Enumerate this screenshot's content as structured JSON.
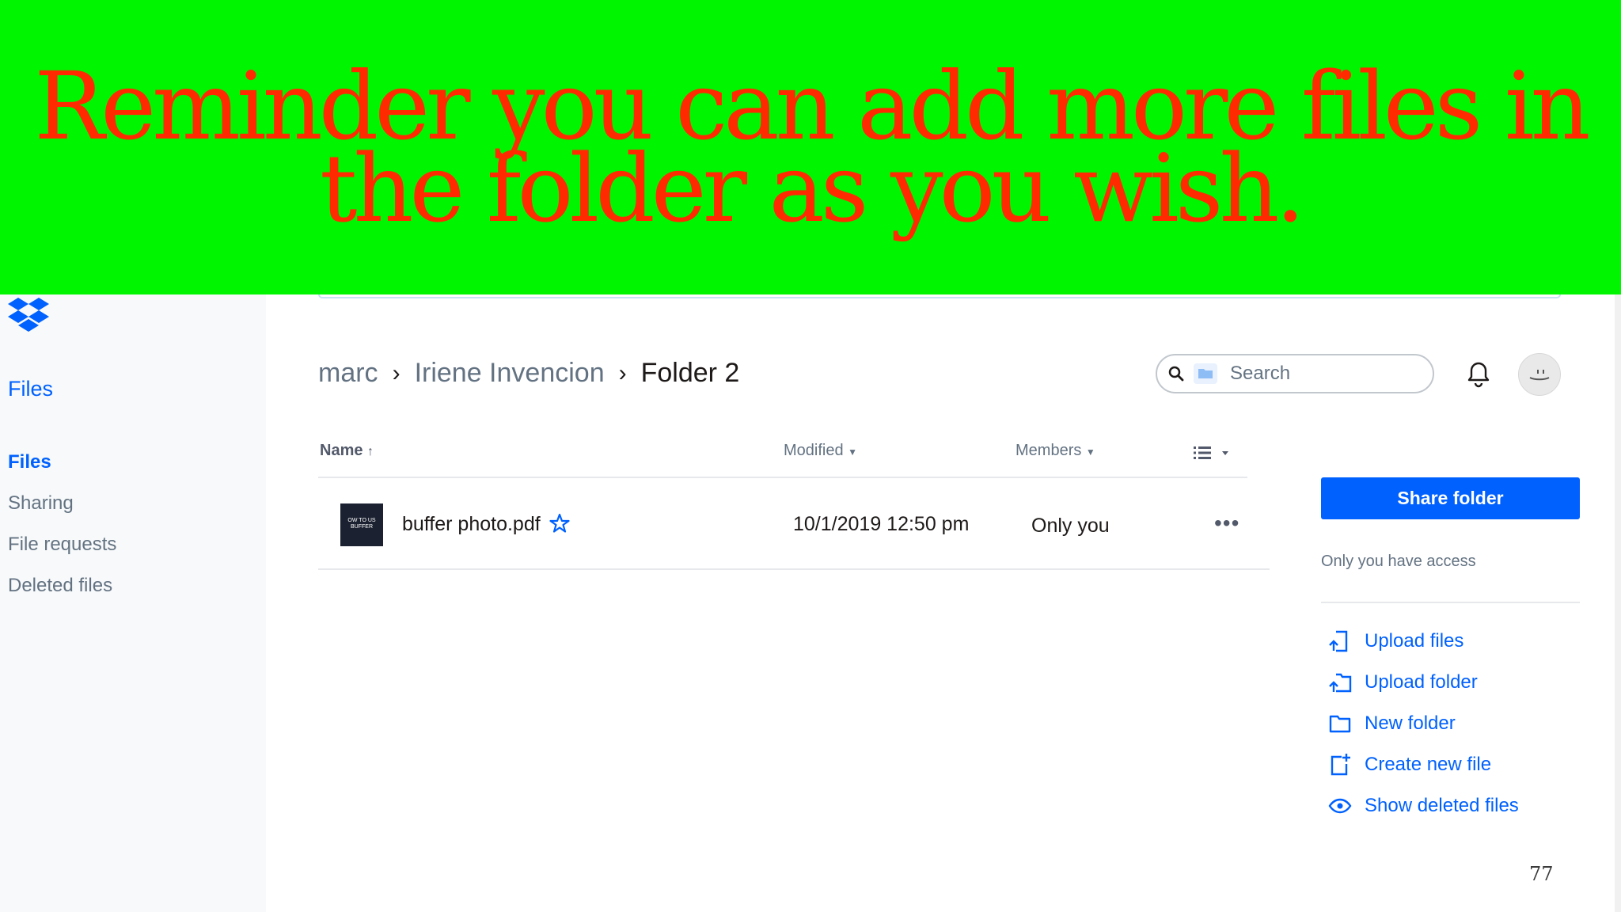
{
  "banner": {
    "line1": "Reminder you can add more files in",
    "line2": "the folder as you wish."
  },
  "sidebar": {
    "title": "Files",
    "items": [
      {
        "label": "Files",
        "active": true
      },
      {
        "label": "Sharing"
      },
      {
        "label": "File requests"
      },
      {
        "label": "Deleted files"
      }
    ]
  },
  "breadcrumb": {
    "items": [
      "marc",
      "Iriene Invencion"
    ],
    "current": "Folder 2"
  },
  "search": {
    "placeholder": "Search"
  },
  "table": {
    "columns": {
      "name": "Name",
      "modified": "Modified",
      "members": "Members"
    },
    "rows": [
      {
        "name": "buffer photo.pdf",
        "thumb_text": "OW TO US BUFFER",
        "modified": "10/1/2019 12:50 pm",
        "members": "Only you",
        "more": "•••"
      }
    ]
  },
  "panel": {
    "share_label": "Share folder",
    "access_note": "Only you have access",
    "actions": [
      {
        "label": "Upload files",
        "icon": "upload-file-icon"
      },
      {
        "label": "Upload folder",
        "icon": "upload-folder-icon"
      },
      {
        "label": "New folder",
        "icon": "new-folder-icon"
      },
      {
        "label": "Create new file",
        "icon": "new-file-icon"
      },
      {
        "label": "Show deleted files",
        "icon": "eye-icon"
      }
    ]
  },
  "page_number": "77",
  "colors": {
    "accent": "#0061fe",
    "banner_bg": "#00f500",
    "banner_text": "#ff2a00"
  }
}
